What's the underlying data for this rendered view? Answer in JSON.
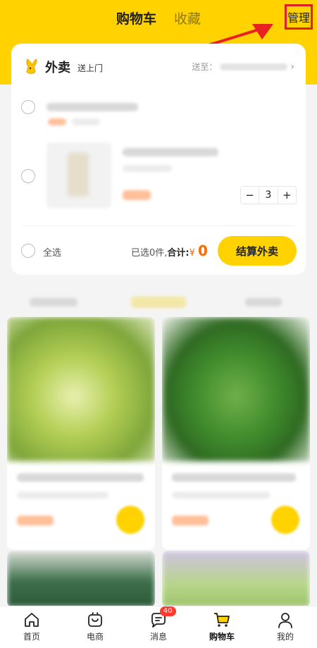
{
  "header": {
    "tabs": [
      {
        "label": "购物车"
      },
      {
        "label": "收藏"
      }
    ],
    "manage_label": "管理"
  },
  "cart": {
    "store_name": "外卖",
    "store_subtitle": "送上门",
    "deliver_to_label": "送至：",
    "item_quantity": "3",
    "minus": "−",
    "plus": "+",
    "select_all_label": "全选",
    "selected_count_text": "已选0件,",
    "total_label": "合计:",
    "currency": "¥",
    "total_amount": "0",
    "checkout_label": "结算外卖"
  },
  "nav": {
    "items": [
      {
        "label": "首页",
        "icon": "home-icon"
      },
      {
        "label": "电商",
        "icon": "shop-icon"
      },
      {
        "label": "消息",
        "icon": "message-icon",
        "badge": "40"
      },
      {
        "label": "购物车",
        "icon": "cart-icon"
      },
      {
        "label": "我的",
        "icon": "profile-icon"
      }
    ]
  },
  "colors": {
    "brand_yellow": "#ffd200",
    "price_orange": "#ff6a00",
    "highlight_red": "#e02020",
    "badge_red": "#ff3b30"
  }
}
